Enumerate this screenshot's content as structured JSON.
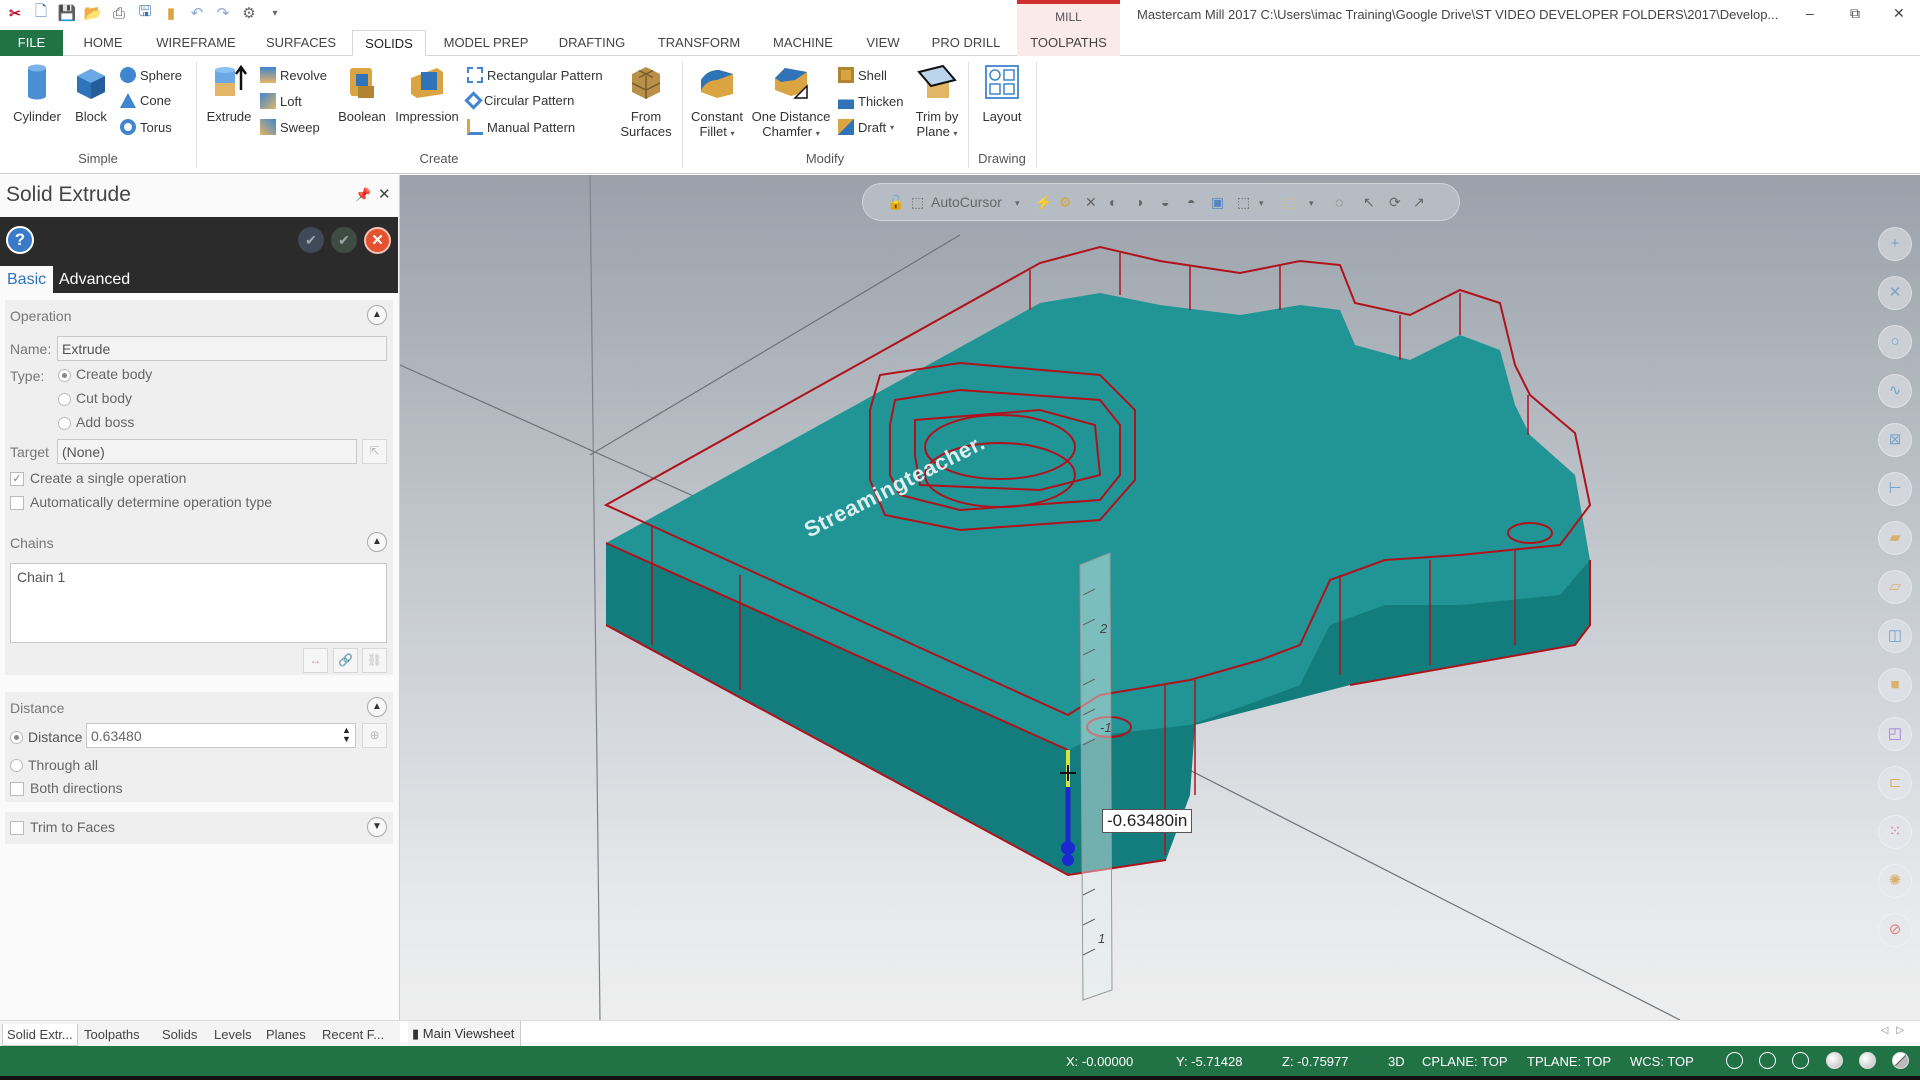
{
  "titlebar": {
    "context_tab_group": "MILL",
    "window_title": "Mastercam Mill 2017  C:\\Users\\imac Training\\Google Drive\\ST VIDEO DEVELOPER FOLDERS\\2017\\Develop...",
    "minimize": "–",
    "restore": "⧉",
    "close": "✕",
    "quick_access": [
      "mastercam-logo",
      "new-file-icon",
      "save-icon",
      "open-icon",
      "print-icon",
      "save-as-icon",
      "pin-icon",
      "undo-icon",
      "redo-icon",
      "gear-dropdown-icon",
      "customize-icon"
    ]
  },
  "tabs": [
    {
      "label": "FILE"
    },
    {
      "label": "HOME"
    },
    {
      "label": "WIREFRAME"
    },
    {
      "label": "SURFACES"
    },
    {
      "label": "SOLIDS",
      "active": true
    },
    {
      "label": "MODEL PREP"
    },
    {
      "label": "DRAFTING"
    },
    {
      "label": "TRANSFORM"
    },
    {
      "label": "MACHINE"
    },
    {
      "label": "VIEW"
    },
    {
      "label": "PRO DRILL"
    },
    {
      "label": "TOOLPATHS"
    }
  ],
  "ribbon": {
    "groups": {
      "simple": "Simple",
      "create": "Create",
      "modify": "Modify",
      "drawing": "Drawing"
    },
    "simple": {
      "cylinder": "Cylinder",
      "block": "Block",
      "sphere": "Sphere",
      "cone": "Cone",
      "torus": "Torus"
    },
    "create": {
      "extrude": "Extrude",
      "revolve": "Revolve",
      "loft": "Loft",
      "sweep": "Sweep",
      "boolean": "Boolean",
      "impression": "Impression",
      "rectangular_pattern": "Rectangular Pattern",
      "circular_pattern": "Circular Pattern",
      "manual_pattern": "Manual Pattern",
      "from_surfaces_1": "From",
      "from_surfaces_2": "Surfaces"
    },
    "modify": {
      "constant_fillet_1": "Constant",
      "constant_fillet_2": "Fillet",
      "one_distance_chamfer_1": "One Distance",
      "one_distance_chamfer_2": "Chamfer",
      "shell": "Shell",
      "thicken": "Thicken",
      "draft": "Draft",
      "trim_by_plane_1": "Trim by",
      "trim_by_plane_2": "Plane"
    },
    "drawing": {
      "layout": "Layout"
    }
  },
  "panel": {
    "title": "Solid Extrude",
    "tabs": {
      "basic": "Basic",
      "advanced": "Advanced"
    },
    "operation": {
      "title": "Operation",
      "name_label": "Name:",
      "name_value": "Extrude",
      "type_label": "Type:",
      "type_options": [
        "Create body",
        "Cut body",
        "Add boss"
      ],
      "type_selected": "Create body",
      "target_label": "Target",
      "target_value": "(None)",
      "single_operation": "Create a single operation",
      "single_operation_checked": true,
      "auto_determine": "Automatically determine operation type",
      "auto_determine_checked": false
    },
    "chains": {
      "title": "Chains",
      "items": [
        "Chain  1"
      ]
    },
    "distance": {
      "title": "Distance",
      "distance_label": "Distance",
      "distance_value": "0.63480",
      "through_all": "Through all",
      "both_directions": "Both directions",
      "selected": "Distance"
    },
    "trim": {
      "label": "Trim to Faces",
      "checked": false
    }
  },
  "bottom_tabs": [
    "Solid Extr...",
    "Toolpaths",
    "Solids",
    "Levels",
    "Planes",
    "Recent F..."
  ],
  "viewsheet": {
    "label": "Main Viewsheet"
  },
  "viewport": {
    "autocursor_label": "AutoCursor",
    "dimension_label": "-0.63480in",
    "watermark": "Streamingteacher.",
    "ruler_ticks": [
      "2",
      "-1",
      "1"
    ],
    "model_face_color": "#1f8f8f",
    "model_edge_color": "#b0121c"
  },
  "status": {
    "x": "X:  -0.00000",
    "y": "Y:  -5.71428",
    "z": "Z:  -0.75977",
    "mode": "3D",
    "cplane": "CPLANE: TOP",
    "tplane": "TPLANE: TOP",
    "wcs": "WCS: TOP"
  },
  "colors": {
    "accent_green": "#217346",
    "context_red": "#d32f2f",
    "panel_dark": "#2b2b2b"
  }
}
